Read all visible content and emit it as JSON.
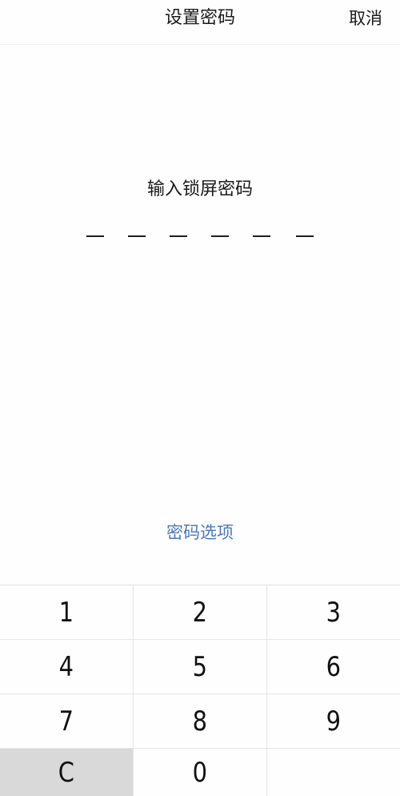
{
  "header": {
    "title": "设置密码",
    "cancel_label": "取消"
  },
  "prompt": {
    "text": "输入锁屏密码"
  },
  "pin": {
    "length": 6,
    "entered": 0
  },
  "options": {
    "label": "密码选项"
  },
  "keypad": {
    "keys": [
      {
        "label": "1",
        "name": "key-1"
      },
      {
        "label": "2",
        "name": "key-2"
      },
      {
        "label": "3",
        "name": "key-3"
      },
      {
        "label": "4",
        "name": "key-4"
      },
      {
        "label": "5",
        "name": "key-5"
      },
      {
        "label": "6",
        "name": "key-6"
      },
      {
        "label": "7",
        "name": "key-7"
      },
      {
        "label": "8",
        "name": "key-8"
      },
      {
        "label": "9",
        "name": "key-9"
      },
      {
        "label": "C",
        "name": "clear-key"
      },
      {
        "label": "0",
        "name": "key-0"
      },
      {
        "label": "",
        "name": "empty-key"
      }
    ]
  },
  "colors": {
    "link": "#4a79bf",
    "clear_key_bg": "#d9d9d9"
  }
}
